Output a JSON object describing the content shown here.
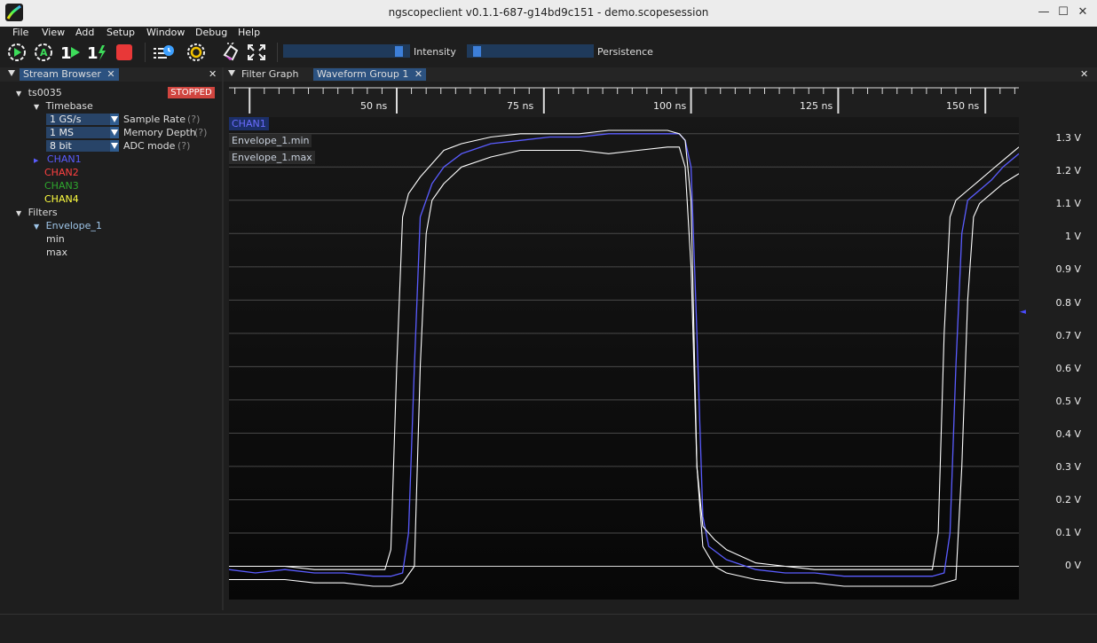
{
  "window": {
    "title": "ngscopeclient v0.1.1-687-g14bd9c151  - demo.scopesession",
    "minimize": "—",
    "maximize": "☐",
    "close": "✕"
  },
  "menu": [
    "File",
    "View",
    "Add",
    "Setup",
    "Window",
    "Debug",
    "Help"
  ],
  "toolbar": {
    "intensity_label": "Intensity",
    "persistence_label": "Persistence",
    "intensity_level": 0.95,
    "persistence_level": 0.04,
    "icons": [
      "trigger-start-icon",
      "trigger-auto-icon",
      "trigger-single-icon",
      "trigger-force-icon",
      "trigger-stop-icon",
      "history-icon",
      "preferences-icon",
      "color-picker-icon",
      "fullscreen-icon"
    ]
  },
  "stream_browser": {
    "tab_label": "Stream Browser",
    "tab_close": "✕",
    "panel_close": "✕",
    "instrument": "ts0035",
    "status": "STOPPED",
    "timebase_label": "Timebase",
    "settings": [
      {
        "value": "1 GS/s",
        "label": "Sample Rate",
        "help": "(?)"
      },
      {
        "value": "1 MS",
        "label": "Memory Depth",
        "help": "(?)"
      },
      {
        "value": "8 bit",
        "label": "ADC mode",
        "help": "(?)"
      }
    ],
    "channels": [
      {
        "name": "CHAN1",
        "color": "#5a5cff"
      },
      {
        "name": "CHAN2",
        "color": "#ff4040"
      },
      {
        "name": "CHAN3",
        "color": "#2ea82e"
      },
      {
        "name": "CHAN4",
        "color": "#ffff40"
      }
    ],
    "filters_label": "Filters",
    "filter_name": "Envelope_1",
    "filter_streams": [
      "min",
      "max"
    ]
  },
  "waveform_area": {
    "tabs": [
      {
        "label": "Filter Graph",
        "active": false
      },
      {
        "label": "Waveform Group 1",
        "active": true
      }
    ],
    "tab_close": "✕",
    "panel_close": "✕",
    "overlays": [
      "CHAN1",
      "Envelope_1.min",
      "Envelope_1.max"
    ],
    "time_ticks": [
      "50 ns",
      "75 ns",
      "100 ns",
      "125 ns",
      "150 ns"
    ],
    "volt_ticks": [
      "1.3 V",
      "1.2 V",
      "1.1 V",
      "1 V",
      "0.9 V",
      "0.8 V",
      "0.7 V",
      "0.6 V",
      "0.5 V",
      "0.4 V",
      "0.3 V",
      "0.2 V",
      "0.1 V",
      "0 V"
    ],
    "trigger_marker": "◄"
  },
  "chart_data": {
    "type": "line",
    "xlabel": "",
    "ylabel": "",
    "xlim": [
      21.5,
      155.7
    ],
    "ylim": [
      -0.1,
      1.35
    ],
    "x_unit": "ns",
    "y_unit": "V",
    "trigger_level": 0.77,
    "series": [
      {
        "name": "CHAN1",
        "color": "#5a5cff",
        "x": [
          21.5,
          26,
          31,
          36,
          41,
          46,
          49,
          51,
          52,
          53,
          54,
          56,
          58,
          61,
          66,
          71,
          76,
          81,
          86,
          91,
          96,
          98,
          99,
          100,
          101,
          102,
          103,
          106,
          111,
          116,
          121,
          126,
          131,
          136,
          141,
          143,
          144,
          145,
          146,
          147,
          149,
          151,
          153,
          155.7
        ],
        "y": [
          -0.01,
          -0.02,
          -0.01,
          -0.02,
          -0.02,
          -0.03,
          -0.03,
          -0.02,
          0.1,
          0.6,
          1.05,
          1.15,
          1.2,
          1.24,
          1.27,
          1.28,
          1.29,
          1.29,
          1.3,
          1.3,
          1.3,
          1.3,
          1.28,
          1.2,
          0.7,
          0.15,
          0.06,
          0.02,
          -0.01,
          -0.02,
          -0.02,
          -0.03,
          -0.03,
          -0.03,
          -0.03,
          -0.02,
          0.1,
          0.6,
          1.0,
          1.1,
          1.13,
          1.16,
          1.2,
          1.24
        ]
      },
      {
        "name": "Envelope_1.min",
        "color": "#ffffff",
        "x": [
          21.5,
          26,
          31,
          36,
          41,
          46,
          49,
          51,
          53,
          54,
          55,
          56,
          58,
          61,
          66,
          71,
          76,
          81,
          86,
          91,
          96,
          98,
          99,
          100,
          101,
          102,
          104,
          106,
          111,
          116,
          121,
          126,
          131,
          136,
          141,
          145,
          146,
          147,
          148,
          149,
          151,
          153,
          155.7
        ],
        "y": [
          -0.04,
          -0.04,
          -0.04,
          -0.05,
          -0.05,
          -0.06,
          -0.06,
          -0.05,
          0.0,
          0.6,
          1.0,
          1.1,
          1.15,
          1.2,
          1.23,
          1.25,
          1.25,
          1.25,
          1.24,
          1.25,
          1.26,
          1.26,
          1.2,
          0.9,
          0.3,
          0.06,
          0.0,
          -0.02,
          -0.04,
          -0.05,
          -0.05,
          -0.06,
          -0.06,
          -0.06,
          -0.06,
          -0.04,
          0.3,
          0.8,
          1.05,
          1.09,
          1.12,
          1.15,
          1.18
        ]
      },
      {
        "name": "Envelope_1.max",
        "color": "#ffffff",
        "x": [
          21.5,
          26,
          31,
          36,
          41,
          46,
          48,
          49,
          50,
          51,
          52,
          54,
          56,
          58,
          61,
          66,
          71,
          76,
          81,
          86,
          91,
          96,
          98,
          99,
          100,
          101,
          102,
          104,
          106,
          111,
          116,
          121,
          126,
          131,
          136,
          141,
          142,
          143,
          144,
          145,
          147,
          149,
          151,
          153,
          155.7
        ],
        "y": [
          0.0,
          0.0,
          0.0,
          -0.01,
          -0.01,
          -0.01,
          -0.01,
          0.05,
          0.6,
          1.05,
          1.12,
          1.17,
          1.21,
          1.25,
          1.27,
          1.29,
          1.3,
          1.3,
          1.3,
          1.31,
          1.31,
          1.31,
          1.3,
          1.28,
          1.1,
          0.3,
          0.12,
          0.08,
          0.05,
          0.01,
          0.0,
          -0.01,
          -0.01,
          -0.01,
          -0.01,
          -0.01,
          0.1,
          0.7,
          1.05,
          1.1,
          1.13,
          1.16,
          1.19,
          1.22,
          1.26
        ]
      }
    ]
  }
}
